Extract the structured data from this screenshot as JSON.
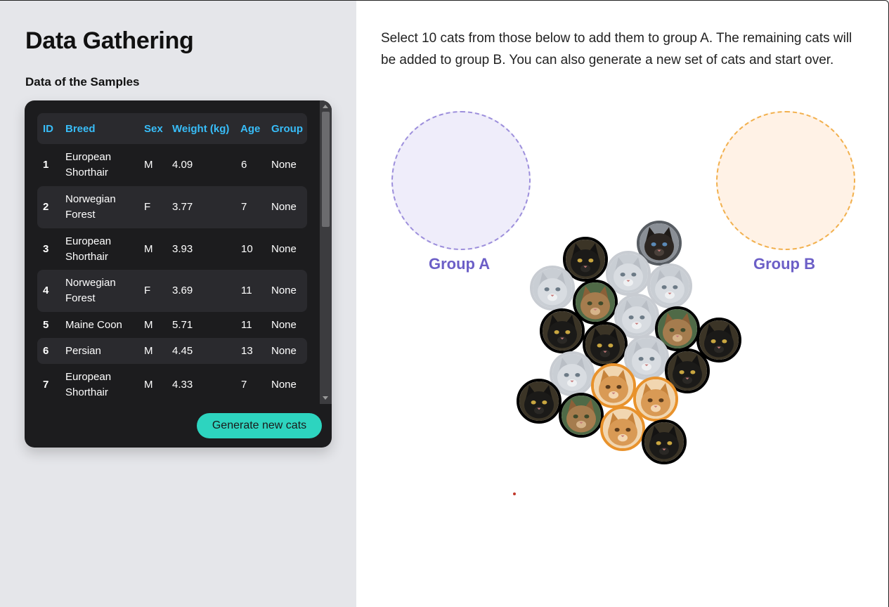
{
  "sidebar": {
    "title": "Data Gathering",
    "subtitle": "Data of the Samples",
    "generate_label": "Generate new cats"
  },
  "table": {
    "headers": [
      "ID",
      "Breed",
      "Sex",
      "Weight (kg)",
      "Age",
      "Group"
    ],
    "rows": [
      {
        "id": "1",
        "breed": "European Shorthair",
        "sex": "M",
        "weight": "4.09",
        "age": "6",
        "group": "None"
      },
      {
        "id": "2",
        "breed": "Norwegian Forest",
        "sex": "F",
        "weight": "3.77",
        "age": "7",
        "group": "None"
      },
      {
        "id": "3",
        "breed": "European Shorthair",
        "sex": "M",
        "weight": "3.93",
        "age": "10",
        "group": "None"
      },
      {
        "id": "4",
        "breed": "Norwegian Forest",
        "sex": "F",
        "weight": "3.69",
        "age": "11",
        "group": "None"
      },
      {
        "id": "5",
        "breed": "Maine Coon",
        "sex": "M",
        "weight": "5.71",
        "age": "11",
        "group": "None"
      },
      {
        "id": "6",
        "breed": "Persian",
        "sex": "M",
        "weight": "4.45",
        "age": "13",
        "group": "None"
      },
      {
        "id": "7",
        "breed": "European Shorthair",
        "sex": "M",
        "weight": "4.33",
        "age": "7",
        "group": "None"
      }
    ]
  },
  "main": {
    "instructions": "Select 10 cats from those below to add them to group A. The remaining cats will be added to group B. You can also generate a new set of cats and start over.",
    "group_a_label": "Group A",
    "group_b_label": "Group B"
  },
  "colors": {
    "accent_teal": "#2dd4bf",
    "header_blue": "#38bdf8",
    "group_label": "#6c5fc7",
    "group_a_border": "#9d8fdc",
    "group_b_border": "#f2b04d"
  },
  "cats": [
    {
      "kind": "siamese"
    },
    {
      "kind": "black"
    },
    {
      "kind": "persian"
    },
    {
      "kind": "persian"
    },
    {
      "kind": "persian"
    },
    {
      "kind": "tabby"
    },
    {
      "kind": "persian"
    },
    {
      "kind": "black"
    },
    {
      "kind": "tabby"
    },
    {
      "kind": "black"
    },
    {
      "kind": "black"
    },
    {
      "kind": "persian"
    },
    {
      "kind": "black"
    },
    {
      "kind": "persian"
    },
    {
      "kind": "ginger"
    },
    {
      "kind": "ginger"
    },
    {
      "kind": "black"
    },
    {
      "kind": "tabby"
    },
    {
      "kind": "ginger"
    },
    {
      "kind": "black"
    }
  ]
}
